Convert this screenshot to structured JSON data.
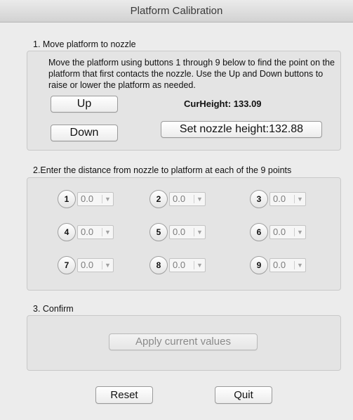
{
  "window": {
    "title": "Platform Calibration"
  },
  "section1": {
    "label": "1. Move platform to nozzle",
    "instructions": "Move the platform using buttons 1 through 9 below to find the point on the platform that first contacts the nozzle.  Use the Up and Down buttons to raise or lower the platform as needed.",
    "up_label": "Up",
    "down_label": "Down",
    "cur_height": "CurHeight: 133.09",
    "set_nozzle_label": "Set nozzle height:132.88"
  },
  "section2": {
    "label": "2.Enter the distance from nozzle to platform at each of the 9 points",
    "points": [
      {
        "num": "1",
        "value": "0.0"
      },
      {
        "num": "2",
        "value": "0.0"
      },
      {
        "num": "3",
        "value": "0.0"
      },
      {
        "num": "4",
        "value": "0.0"
      },
      {
        "num": "5",
        "value": "0.0"
      },
      {
        "num": "6",
        "value": "0.0"
      },
      {
        "num": "7",
        "value": "0.0"
      },
      {
        "num": "8",
        "value": "0.0"
      },
      {
        "num": "9",
        "value": "0.0"
      }
    ]
  },
  "section3": {
    "label": "3. Confirm",
    "apply_label": "Apply current values"
  },
  "footer": {
    "reset_label": "Reset",
    "quit_label": "Quit"
  }
}
